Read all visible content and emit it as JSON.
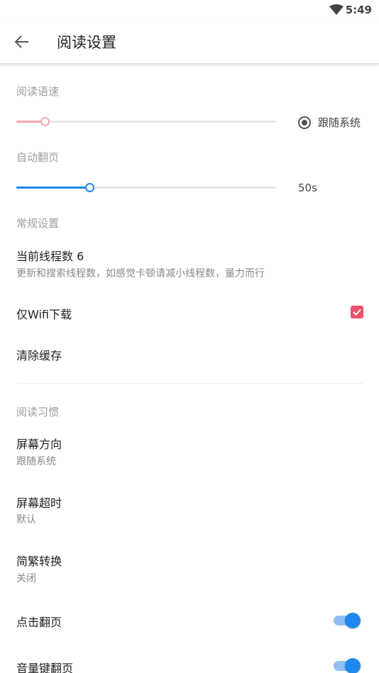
{
  "status_bar": {
    "time": "5:49",
    "wifi_icon": "wifi-icon"
  },
  "toolbar": {
    "title": "阅读设置",
    "back_icon": "arrow-left-icon"
  },
  "reading_speed": {
    "header": "阅读语速",
    "slider_value": 0.11,
    "accent_color": "#f4a8b7",
    "follow_system_label": "跟随系统",
    "follow_system_selected": true
  },
  "auto_page": {
    "header": "自动翻页",
    "slider_value": 0.28,
    "accent_color": "#1e88f0",
    "value_label": "50s"
  },
  "general": {
    "header": "常规设置",
    "threads_title": "当前线程数 6",
    "threads_summary": "更新和搜索线程数，如感觉卡顿请减小线程数，量力而行",
    "wifi_only_title": "仅Wifi下载",
    "wifi_only_checked": true,
    "checkbox_color": "#e9506a",
    "clear_cache_title": "清除缓存"
  },
  "habits": {
    "header": "阅读习惯",
    "orientation_title": "屏幕方向",
    "orientation_summary": "跟随系统",
    "timeout_title": "屏幕超时",
    "timeout_summary": "默认",
    "convert_title": "简繁转换",
    "convert_summary": "关闭",
    "tap_page_title": "点击翻页",
    "tap_page_on": true,
    "volume_page_title": "音量键翻页",
    "volume_page_on": true,
    "switch_color": "#1e88f0"
  }
}
